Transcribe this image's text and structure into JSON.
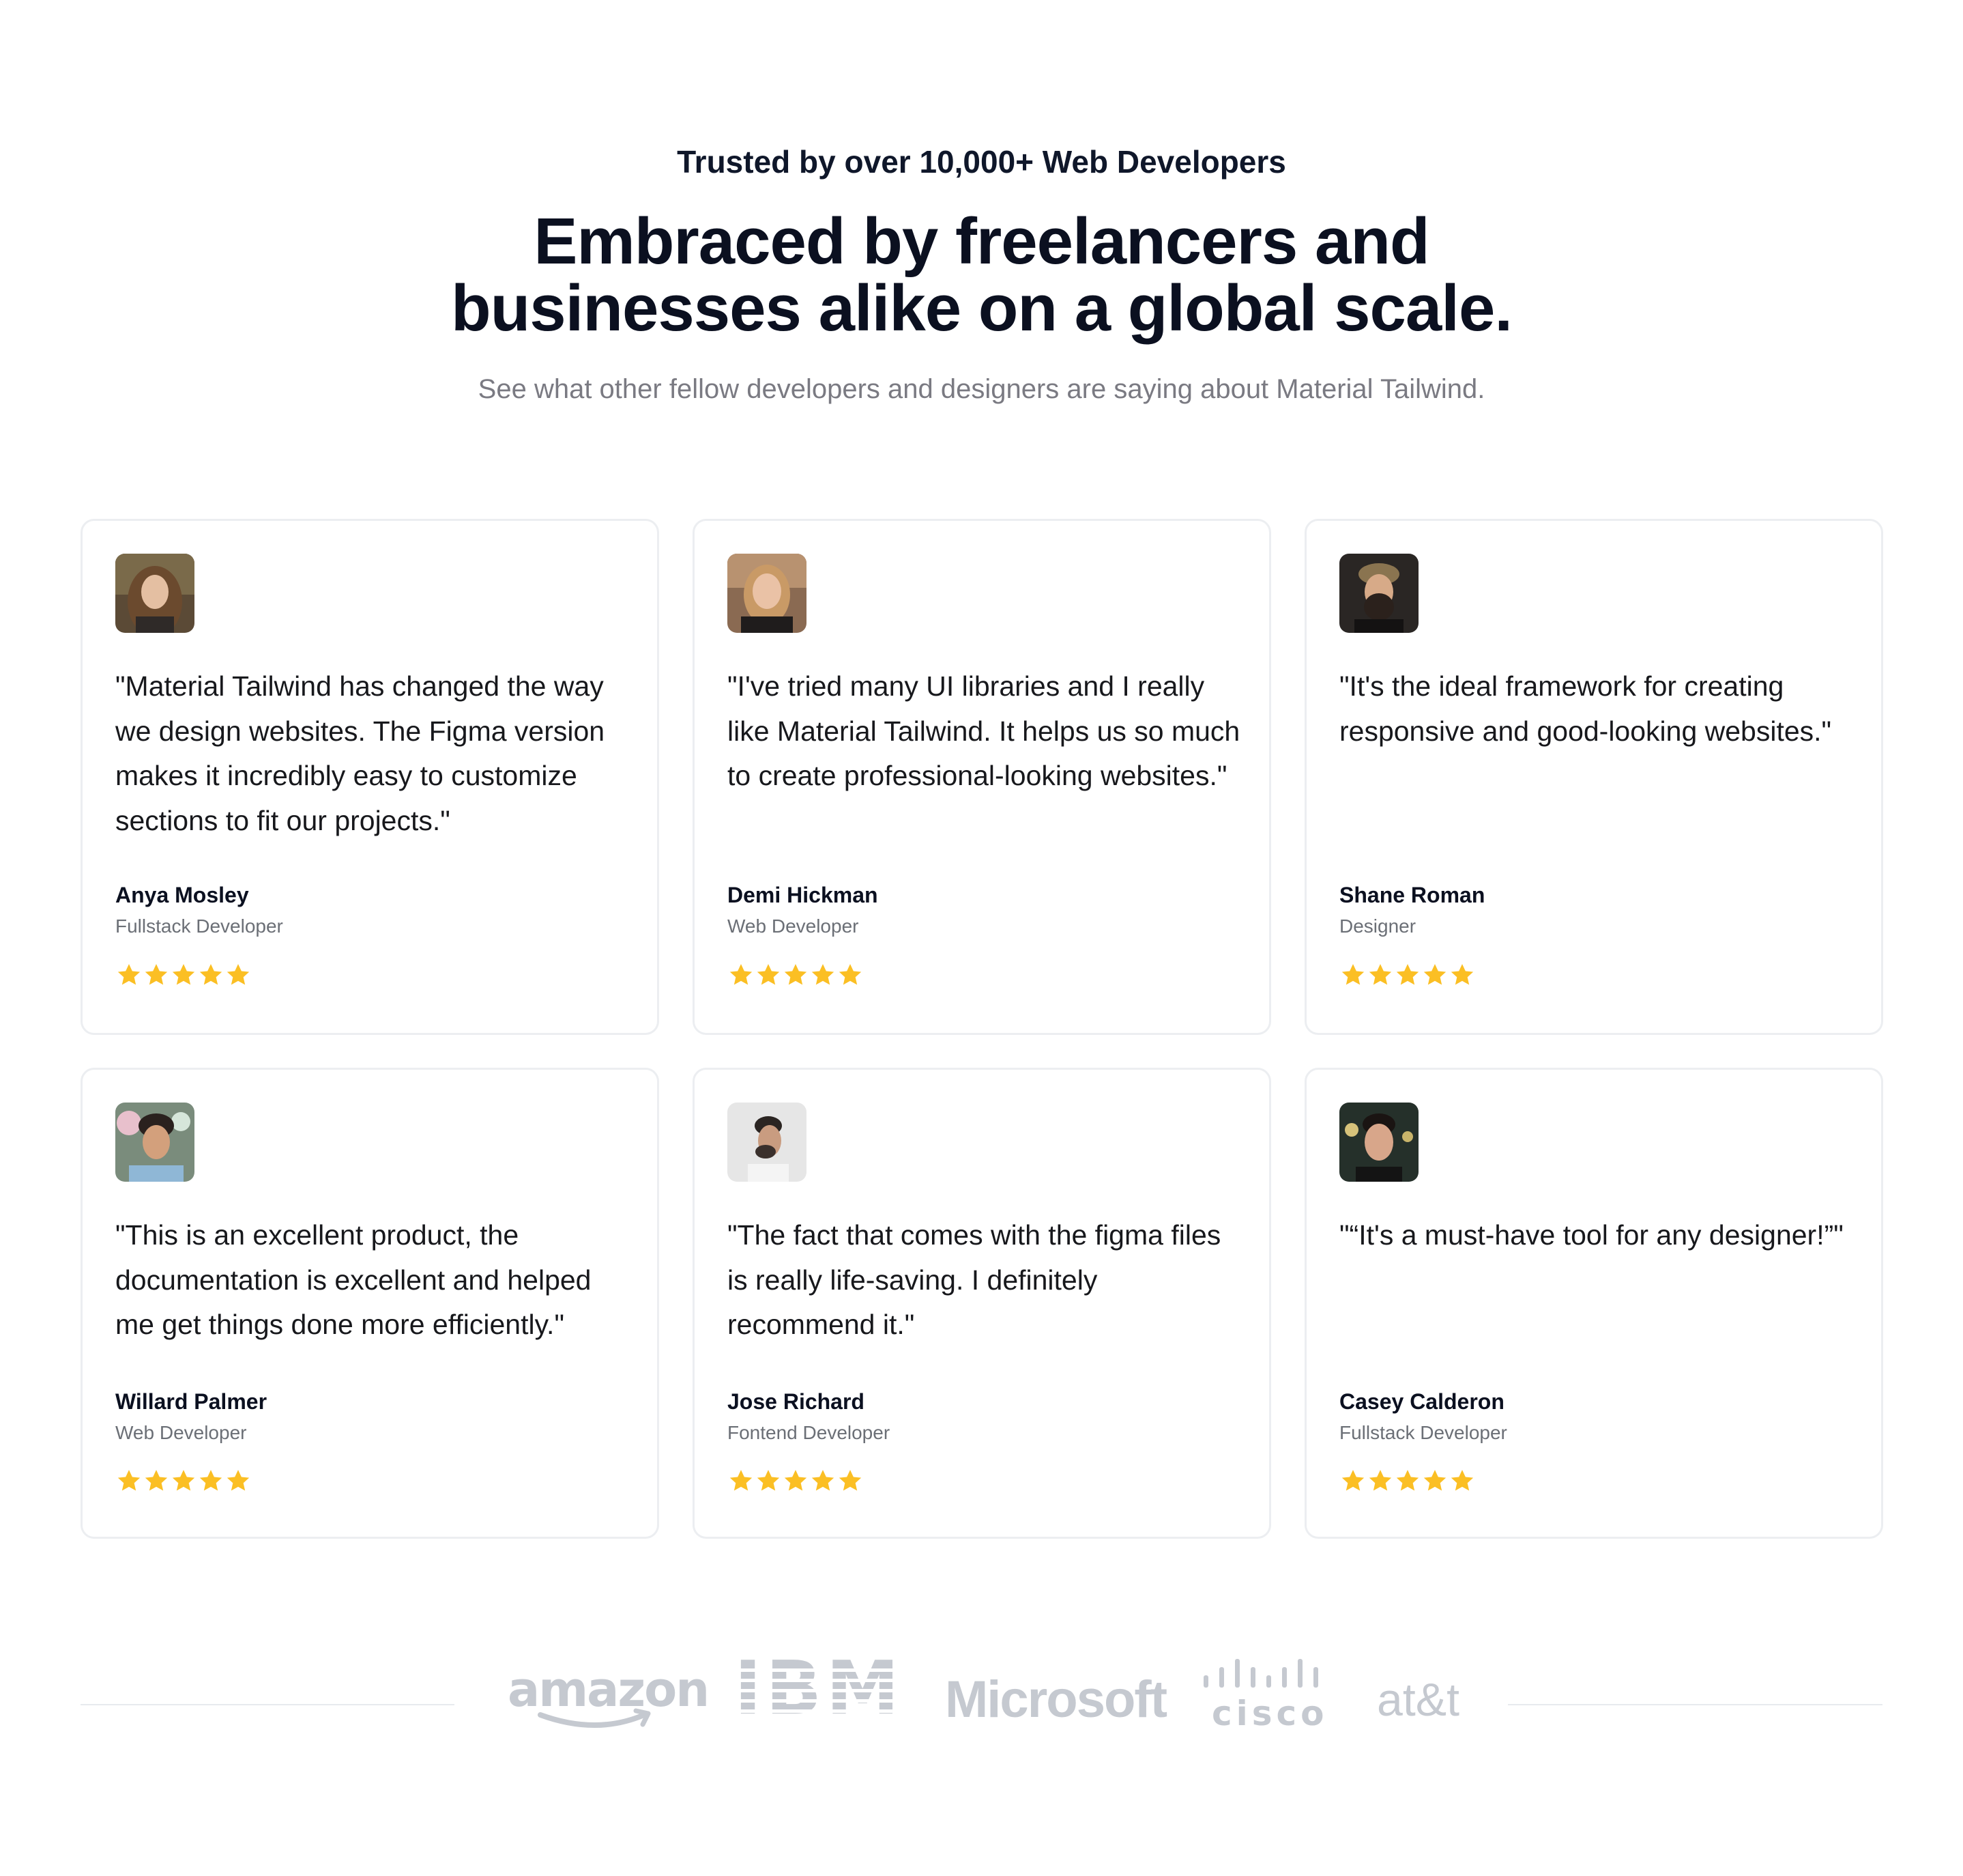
{
  "header": {
    "eyebrow": "Trusted by over 10,000+ Web Developers",
    "headline_line1": "Embraced by freelancers and",
    "headline_line2": "businesses alike on a global scale.",
    "subtitle": "See what other fellow developers and designers are saying about Material Tailwind."
  },
  "colors": {
    "star": "#fbbf24",
    "border": "#eceef1",
    "logo": "#c5c9d0"
  },
  "testimonials": [
    {
      "quote": "\"Material Tailwind has changed the way we design websites. The Figma version makes it incredibly easy to customize sections to fit our projects.\"",
      "name": "Anya Mosley",
      "role": "Fullstack Developer",
      "rating": 5
    },
    {
      "quote": "\"I've tried many UI libraries and I really like Material Tailwind. It helps us so much to create professional-looking websites.\"",
      "name": "Demi Hickman",
      "role": "Web Developer",
      "rating": 5
    },
    {
      "quote": "\"It's the ideal framework for creating responsive and good-looking websites.\"",
      "name": "Shane Roman",
      "role": "Designer",
      "rating": 5
    },
    {
      "quote": "\"This is an excellent product, the documentation is excellent and helped me get things done more efficiently.\"",
      "name": "Willard Palmer",
      "role": "Web Developer",
      "rating": 5
    },
    {
      "quote": "\"The fact that comes with the figma files is really life-saving. I definitely recommend it.\"",
      "name": "Jose Richard",
      "role": "Fontend Developer",
      "rating": 5
    },
    {
      "quote": "\"“It's a must-have tool for any designer!”\"",
      "name": "Casey Calderon",
      "role": "Fullstack Developer",
      "rating": 5
    }
  ],
  "logos": {
    "amazon": "amazon",
    "ibm": "IBM",
    "microsoft": "Microsoft",
    "cisco": "cisco",
    "att": "at&t"
  }
}
